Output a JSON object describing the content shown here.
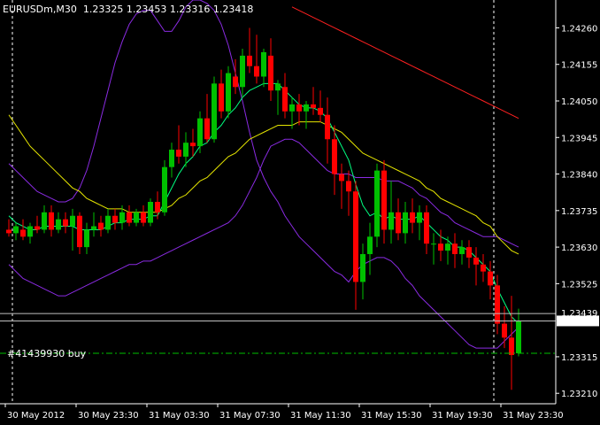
{
  "header": {
    "symbol": "EURUSDm,M30",
    "open": "1.23325",
    "high": "1.23453",
    "low": "1.23316",
    "close": "1.23418"
  },
  "order_label": "#41439930 buy",
  "colors": {
    "background": "#000000",
    "bull": "#00c000",
    "bear": "#ff0000",
    "bands": "#8a2be2",
    "ma_fast": "#00ff80",
    "ma_mid": "#e6e600",
    "ma_slow": "#ff2020",
    "order_line": "#00c000",
    "grid": "#ffffff"
  },
  "chart_data": {
    "type": "candlestick",
    "title": "EURUSDm,M30",
    "y_ticks": [
      "1.24260",
      "1.24155",
      "1.24050",
      "1.23945",
      "1.23840",
      "1.23735",
      "1.23630",
      "1.23525",
      "1.23418",
      "1.23315",
      "1.23210"
    ],
    "ylim": [
      1.2318,
      1.2434
    ],
    "current_price": 1.23418,
    "ask_price": 1.23439,
    "ask_label": "1.23439",
    "order_price": 1.23325,
    "x_ticks": [
      "30 May 2012",
      "30 May 23:30",
      "31 May 03:30",
      "31 May 07:30",
      "31 May 11:30",
      "31 May 15:30",
      "31 May 19:30",
      "31 May 23:30"
    ],
    "day_separators": [
      1,
      69
    ],
    "candles": [
      [
        1.2368,
        1.2371,
        1.2366,
        1.2367
      ],
      [
        1.2367,
        1.237,
        1.2365,
        1.2369
      ],
      [
        1.2368,
        1.2371,
        1.2365,
        1.2366
      ],
      [
        1.2366,
        1.237,
        1.2364,
        1.2369
      ],
      [
        1.2369,
        1.2372,
        1.2367,
        1.2368
      ],
      [
        1.2368,
        1.2375,
        1.2367,
        1.2373
      ],
      [
        1.2373,
        1.2375,
        1.2366,
        1.2368
      ],
      [
        1.2368,
        1.2373,
        1.2367,
        1.2371
      ],
      [
        1.2371,
        1.2373,
        1.2367,
        1.2369
      ],
      [
        1.2369,
        1.2374,
        1.2362,
        1.2372
      ],
      [
        1.2372,
        1.2373,
        1.2361,
        1.2363
      ],
      [
        1.2363,
        1.237,
        1.2361,
        1.2368
      ],
      [
        1.2368,
        1.2373,
        1.2366,
        1.2369
      ],
      [
        1.237,
        1.2372,
        1.2366,
        1.2368
      ],
      [
        1.2368,
        1.2374,
        1.2367,
        1.2372
      ],
      [
        1.2372,
        1.2374,
        1.2368,
        1.237
      ],
      [
        1.237,
        1.2375,
        1.2368,
        1.2373
      ],
      [
        1.2373,
        1.2375,
        1.2369,
        1.237
      ],
      [
        1.237,
        1.2374,
        1.2369,
        1.2373
      ],
      [
        1.2373,
        1.2375,
        1.2369,
        1.237
      ],
      [
        1.237,
        1.2377,
        1.2369,
        1.2376
      ],
      [
        1.2376,
        1.2379,
        1.2371,
        1.2373
      ],
      [
        1.2373,
        1.2388,
        1.2372,
        1.2386
      ],
      [
        1.2386,
        1.2393,
        1.2383,
        1.2391
      ],
      [
        1.2391,
        1.2398,
        1.2387,
        1.2389
      ],
      [
        1.2389,
        1.2396,
        1.2386,
        1.2393
      ],
      [
        1.2393,
        1.2397,
        1.2389,
        1.2392
      ],
      [
        1.2392,
        1.2402,
        1.239,
        1.24
      ],
      [
        1.24,
        1.2407,
        1.2393,
        1.2394
      ],
      [
        1.2394,
        1.2412,
        1.2393,
        1.241
      ],
      [
        1.241,
        1.2414,
        1.24,
        1.2402
      ],
      [
        1.2402,
        1.2415,
        1.24,
        1.2413
      ],
      [
        1.2412,
        1.2417,
        1.2407,
        1.2409
      ],
      [
        1.2409,
        1.242,
        1.2406,
        1.2418
      ],
      [
        1.2418,
        1.2426,
        1.2413,
        1.2415
      ],
      [
        1.2415,
        1.2424,
        1.241,
        1.2412
      ],
      [
        1.2412,
        1.242,
        1.2409,
        1.2419
      ],
      [
        1.2418,
        1.2423,
        1.2405,
        1.2408
      ],
      [
        1.2408,
        1.2411,
        1.2401,
        1.241
      ],
      [
        1.2409,
        1.2413,
        1.24,
        1.2402
      ],
      [
        1.2402,
        1.2406,
        1.2397,
        1.2404
      ],
      [
        1.2404,
        1.2407,
        1.2398,
        1.2402
      ],
      [
        1.2402,
        1.2405,
        1.2397,
        1.2404
      ],
      [
        1.2404,
        1.2409,
        1.2401,
        1.2403
      ],
      [
        1.2403,
        1.2408,
        1.2399,
        1.2401
      ],
      [
        1.2401,
        1.2406,
        1.2387,
        1.2394
      ],
      [
        1.2394,
        1.2398,
        1.2378,
        1.2384
      ],
      [
        1.2384,
        1.2387,
        1.2374,
        1.2382
      ],
      [
        1.2382,
        1.2385,
        1.2372,
        1.2379
      ],
      [
        1.2379,
        1.2382,
        1.2345,
        1.2353
      ],
      [
        1.2353,
        1.2364,
        1.2348,
        1.2361
      ],
      [
        1.2361,
        1.237,
        1.2355,
        1.2366
      ],
      [
        1.2366,
        1.2387,
        1.2363,
        1.2385
      ],
      [
        1.2385,
        1.2388,
        1.2364,
        1.2368
      ],
      [
        1.2368,
        1.2382,
        1.2364,
        1.2373
      ],
      [
        1.2373,
        1.2377,
        1.2365,
        1.2367
      ],
      [
        1.2367,
        1.2376,
        1.2364,
        1.2373
      ],
      [
        1.2373,
        1.2377,
        1.2367,
        1.237
      ],
      [
        1.237,
        1.2375,
        1.2365,
        1.2373
      ],
      [
        1.2373,
        1.2375,
        1.2361,
        1.2364
      ],
      [
        1.2364,
        1.2367,
        1.2358,
        1.2364
      ],
      [
        1.2364,
        1.2368,
        1.2359,
        1.2362
      ],
      [
        1.2362,
        1.2366,
        1.2358,
        1.2364
      ],
      [
        1.2364,
        1.2367,
        1.2357,
        1.2361
      ],
      [
        1.2361,
        1.2365,
        1.2358,
        1.2363
      ],
      [
        1.2363,
        1.2365,
        1.2357,
        1.236
      ],
      [
        1.236,
        1.2363,
        1.2352,
        1.2358
      ],
      [
        1.2358,
        1.2361,
        1.2353,
        1.2356
      ],
      [
        1.2356,
        1.2359,
        1.2348,
        1.2352
      ],
      [
        1.2352,
        1.2355,
        1.2338,
        1.2341
      ],
      [
        1.2341,
        1.2346,
        1.2334,
        1.2337
      ],
      [
        1.2337,
        1.2349,
        1.2322,
        1.2332
      ],
      [
        1.23325,
        1.23453,
        1.23316,
        1.23418
      ]
    ],
    "bb_upper": [
      1.2387,
      1.2385,
      1.2383,
      1.2381,
      1.2379,
      1.2378,
      1.2377,
      1.2376,
      1.2376,
      1.2377,
      1.238,
      1.2385,
      1.2392,
      1.24,
      1.2408,
      1.2416,
      1.2422,
      1.2427,
      1.243,
      1.2431,
      1.2431,
      1.2428,
      1.2425,
      1.2425,
      1.2428,
      1.2432,
      1.2434,
      1.2434,
      1.2433,
      1.2431,
      1.2427,
      1.2421,
      1.2413,
      1.2405,
      1.2396,
      1.2388,
      1.2383,
      1.2379,
      1.2376,
      1.2372,
      1.2369,
      1.2366,
      1.2364,
      1.2362,
      1.236,
      1.2358,
      1.2356,
      1.2355,
      1.2353,
      1.2356,
      1.2358,
      1.2359,
      1.236,
      1.236,
      1.2359,
      1.2357,
      1.2354,
      1.2352,
      1.2349,
      1.2347,
      1.2345,
      1.2343,
      1.2341,
      1.2339,
      1.2337,
      1.2335,
      1.2334,
      1.2334,
      1.2334,
      1.2334,
      1.2336,
      1.2338,
      1.234
    ],
    "bb_lower": [
      1.2358,
      1.2356,
      1.2354,
      1.2353,
      1.2352,
      1.2351,
      1.235,
      1.2349,
      1.2349,
      1.235,
      1.2351,
      1.2352,
      1.2353,
      1.2354,
      1.2355,
      1.2356,
      1.2357,
      1.2358,
      1.2358,
      1.2359,
      1.2359,
      1.236,
      1.2361,
      1.2362,
      1.2363,
      1.2364,
      1.2365,
      1.2366,
      1.2367,
      1.2368,
      1.2369,
      1.237,
      1.2372,
      1.2375,
      1.2379,
      1.2383,
      1.2388,
      1.2392,
      1.2393,
      1.2394,
      1.2394,
      1.2393,
      1.2391,
      1.2389,
      1.2387,
      1.2385,
      1.2384,
      1.2384,
      1.2384,
      1.2383,
      1.2383,
      1.2383,
      1.2383,
      1.2382,
      1.2382,
      1.2382,
      1.2381,
      1.238,
      1.2378,
      1.2377,
      1.2375,
      1.2373,
      1.2372,
      1.237,
      1.2369,
      1.2368,
      1.2367,
      1.2366,
      1.2366,
      1.2366,
      1.2365,
      1.2364,
      1.2363
    ],
    "ma_fast": [
      1.2372,
      1.237,
      1.2369,
      1.2368,
      1.2368,
      1.2369,
      1.2369,
      1.2369,
      1.2369,
      1.2369,
      1.2368,
      1.2368,
      1.2368,
      1.2368,
      1.2369,
      1.237,
      1.237,
      1.2371,
      1.2371,
      1.2371,
      1.2372,
      1.2372,
      1.2376,
      1.238,
      1.2384,
      1.2387,
      1.2389,
      1.2392,
      1.2393,
      1.2396,
      1.2398,
      1.2401,
      1.2403,
      1.2406,
      1.2408,
      1.2409,
      1.241,
      1.241,
      1.241,
      1.2408,
      1.2406,
      1.2404,
      1.2403,
      1.2403,
      1.2402,
      1.24,
      1.2396,
      1.2392,
      1.2388,
      1.2381,
      1.2375,
      1.2372,
      1.2373,
      1.2371,
      1.2372,
      1.2371,
      1.2371,
      1.2371,
      1.2372,
      1.237,
      1.2368,
      1.2366,
      1.2365,
      1.2363,
      1.2363,
      1.2362,
      1.236,
      1.2358,
      1.2356,
      1.2351,
      1.2347,
      1.2343,
      1.2341
    ],
    "ma_mid": [
      1.2401,
      1.2398,
      1.2395,
      1.2392,
      1.239,
      1.2388,
      1.2386,
      1.2384,
      1.2382,
      1.238,
      1.2379,
      1.2377,
      1.2376,
      1.2375,
      1.2374,
      1.2374,
      1.2374,
      1.2373,
      1.2373,
      1.2373,
      1.2373,
      1.2373,
      1.2374,
      1.2375,
      1.2377,
      1.2378,
      1.238,
      1.2382,
      1.2383,
      1.2385,
      1.2387,
      1.2389,
      1.239,
      1.2392,
      1.2394,
      1.2395,
      1.2396,
      1.2397,
      1.2398,
      1.2398,
      1.2398,
      1.2399,
      1.2399,
      1.2399,
      1.2399,
      1.2398,
      1.2397,
      1.2396,
      1.2394,
      1.2392,
      1.239,
      1.2389,
      1.2388,
      1.2387,
      1.2386,
      1.2385,
      1.2384,
      1.2383,
      1.2382,
      1.238,
      1.2379,
      1.2377,
      1.2376,
      1.2375,
      1.2374,
      1.2373,
      1.2372,
      1.237,
      1.2369,
      1.2366,
      1.2364,
      1.2362,
      1.2361
    ],
    "ma_slow": [
      null,
      null,
      null,
      null,
      null,
      null,
      null,
      null,
      null,
      null,
      null,
      null,
      null,
      null,
      null,
      null,
      null,
      null,
      null,
      null,
      null,
      null,
      null,
      null,
      null,
      null,
      null,
      null,
      null,
      null,
      null,
      null,
      null,
      null,
      null,
      null,
      null,
      null,
      null,
      null,
      1.2432,
      1.2431,
      1.243,
      1.2429,
      1.2428,
      1.2427,
      1.2426,
      1.2425,
      1.2424,
      1.2423,
      1.2422,
      1.2421,
      1.242,
      1.2419,
      1.2418,
      1.2417,
      1.2416,
      1.2415,
      1.2414,
      1.2413,
      1.2412,
      1.2411,
      1.241,
      1.2409,
      1.2408,
      1.2407,
      1.2406,
      1.2405,
      1.2404,
      1.2403,
      1.2402,
      1.2401,
      1.24
    ]
  }
}
